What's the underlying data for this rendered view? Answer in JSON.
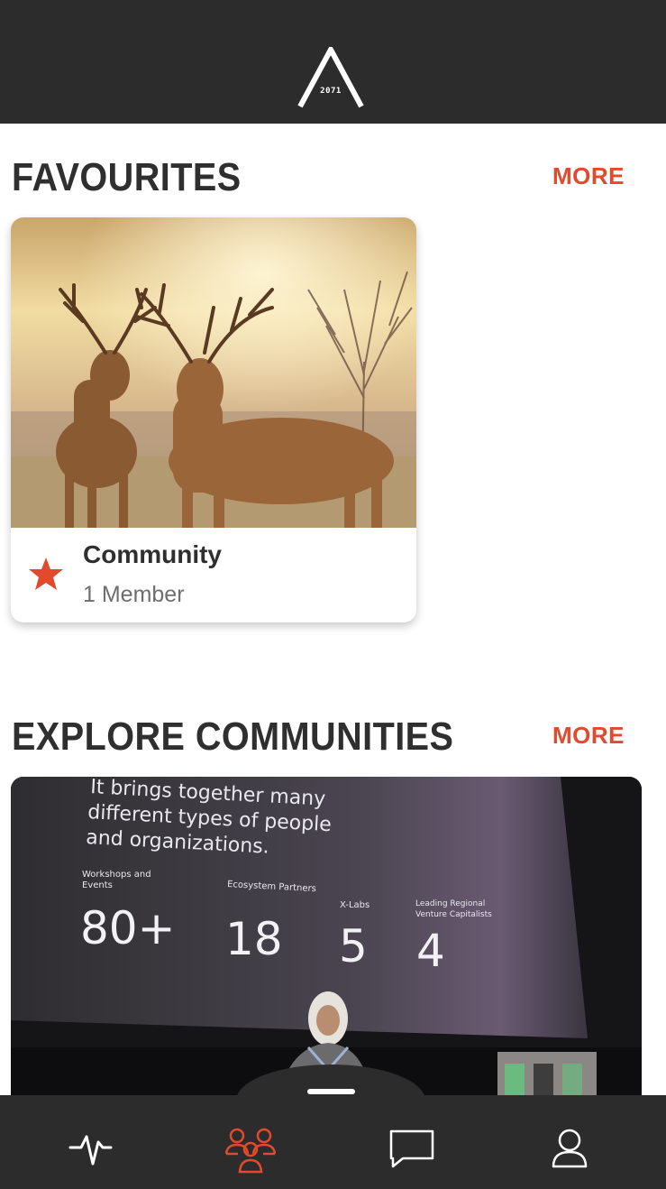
{
  "header": {
    "logo_text": "2071",
    "logo_icon": "mountain-a-logo"
  },
  "favourites": {
    "title": "FAVOURITES",
    "more_label": "MORE",
    "cards": [
      {
        "name": "Community",
        "members": "1 Member",
        "image": "deer-photo",
        "favourite_icon": "star-icon"
      }
    ]
  },
  "explore": {
    "title": "EXPLORE COMMUNITIES",
    "more_label": "MORE",
    "slide": {
      "heading_lines": [
        "It brings together many",
        "different types of people",
        "and organizations."
      ],
      "stats": [
        {
          "label_lines": [
            "Workshops and",
            "Events"
          ],
          "value": "80+"
        },
        {
          "label_lines": [
            "Ecosystem Partners"
          ],
          "value": "18"
        },
        {
          "label_lines": [
            "X-Labs"
          ],
          "value": "5"
        },
        {
          "label_lines": [
            "Leading Regional",
            "Venture Capitalists"
          ],
          "value": "4"
        }
      ]
    }
  },
  "bottom_nav": {
    "items": [
      {
        "name": "activity",
        "icon": "pulse-icon",
        "active": false
      },
      {
        "name": "communities",
        "icon": "people-group-icon",
        "active": true
      },
      {
        "name": "messages",
        "icon": "chat-bubble-icon",
        "active": false
      },
      {
        "name": "profile",
        "icon": "user-icon",
        "active": false
      }
    ]
  },
  "colors": {
    "accent": "#e24a2d",
    "bar": "#2c2c2c",
    "text": "#2f2f2f",
    "muted": "#6e6e6e"
  }
}
